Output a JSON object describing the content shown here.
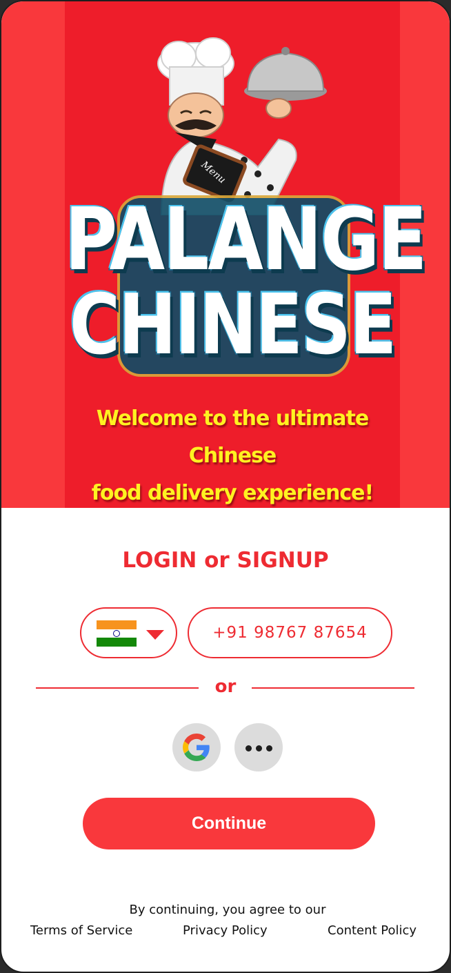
{
  "hero": {
    "logo_line1": "PALANGE",
    "logo_line2": "CHINESE",
    "menu_board_text": "Menu",
    "welcome_line1": "Welcome to the ultimate Chinese",
    "welcome_line2": "food delivery experience!"
  },
  "login": {
    "title": "LOGIN or SIGNUP",
    "country_flag": "india-flag-icon",
    "phone_value": "+91 98767 87654",
    "or_label": "or",
    "social_buttons": [
      "google-icon",
      "more-options-icon"
    ],
    "continue_label": "Continue"
  },
  "footer": {
    "agree_text": "By continuing, you agree to our",
    "links": [
      "Terms of Service",
      "Privacy Policy",
      "Content Policy"
    ]
  },
  "colors": {
    "brand_red": "#ee2b32",
    "hero_outer": "#f9383c",
    "hero_inner": "#ee1d2a",
    "welcome_yellow": "#fff221",
    "button_gray": "#dcdcdc"
  }
}
